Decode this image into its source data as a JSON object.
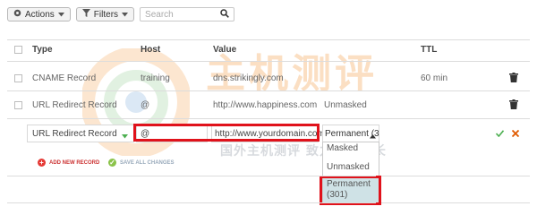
{
  "toolbar": {
    "actions_label": "Actions",
    "filters_label": "Filters",
    "search_placeholder": "Search"
  },
  "table": {
    "headers": [
      "Type",
      "Host",
      "Value",
      "TTL"
    ],
    "rows": [
      {
        "type": "CNAME Record",
        "host": "training",
        "value": "dns.strikingly.com",
        "extra": "",
        "ttl": "60 min"
      },
      {
        "type": "URL Redirect Record",
        "host": "@",
        "value": "http://www.happiness.com",
        "extra": "Unmasked",
        "ttl": ""
      }
    ],
    "edit_row": {
      "type": "URL Redirect Record",
      "host": "@",
      "value": "http://www.yourdomain.com",
      "redirect_selected": "Permanent (3"
    }
  },
  "dropdown": {
    "options": [
      "Masked",
      "Unmasked",
      "Permanent (301)"
    ],
    "highlighted": "Permanent (301)"
  },
  "actions": {
    "add_new_record": "ADD NEW RECORD",
    "save_all_changes": "SAVE ALL CHANGES"
  },
  "watermark": {
    "line1": "主机测评",
    "line2": "国外主机测评 致力个人站长"
  },
  "colors": {
    "highlight_red": "#e0121b",
    "confirm_green": "#4caf50",
    "cancel_orange": "#e05a00",
    "selected_option_bg": "#cfe2e6"
  }
}
